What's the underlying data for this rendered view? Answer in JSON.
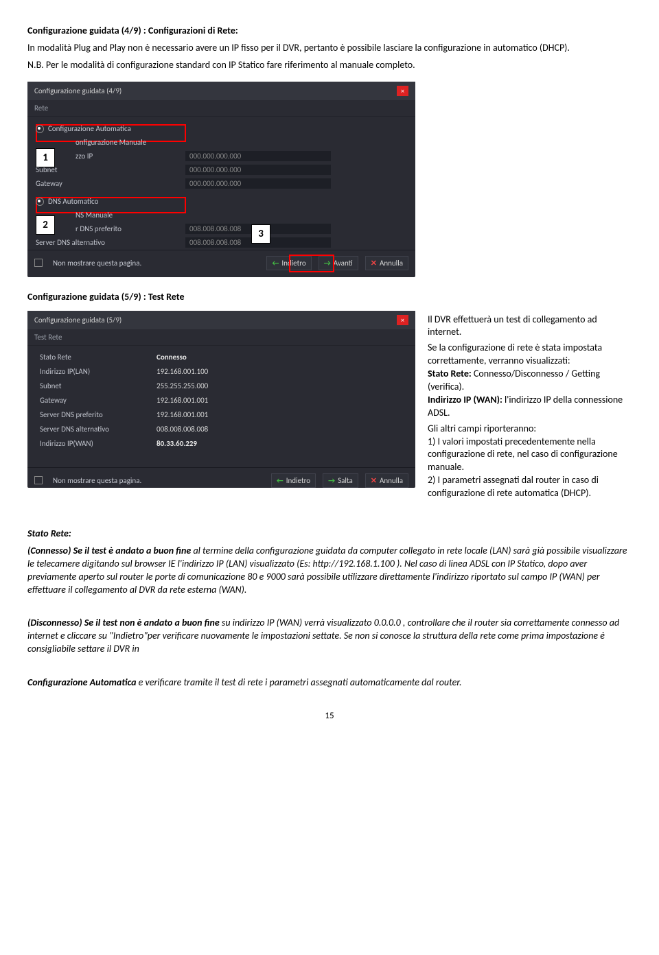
{
  "heading_4_9": "Configurazione guidata (4/9) : Configurazioni di Rete:",
  "intro_para": "In modalità Plug and Play non è necessario avere un IP fisso per il DVR, pertanto è possibile lasciare la configurazione in automatico (DHCP).",
  "nb_line": "N.B. Per le modalità di configurazione standard con IP Statico fare riferimento al manuale completo.",
  "shot1": {
    "title": "Configurazione guidata (4/9)",
    "subtitle": "Rete",
    "radio_auto": "Configurazione Automatica",
    "radio_manual": "onfigurazione Manuale",
    "ip_lbl": "zzo IP",
    "subnet_lbl": "Subnet",
    "gateway_lbl": "Gateway",
    "zeros": "000.000.000.000",
    "radio_dns_auto": "DNS Automatico",
    "radio_dns_manual": "NS Manuale",
    "dns_pref_lbl": "r DNS preferito",
    "dns_alt_lbl": "Server DNS alternativo",
    "eights": "008.008.008.008",
    "noshow": "Non mostrare questa pagina.",
    "back": "Indietro",
    "next": "Avanti",
    "cancel": "Annulla",
    "m1": "1",
    "m2": "2",
    "m3": "3"
  },
  "heading_5_9": "Configurazione guidata (5/9) : Test Rete",
  "shot2": {
    "title": "Configurazione guidata (5/9)",
    "subtitle": "Test Rete",
    "rows": {
      "stato_lbl": "Stato Rete",
      "stato_val": "Connesso",
      "iplan_lbl": "Indirizzo IP(LAN)",
      "iplan_val": "192.168.001.100",
      "subnet_lbl": "Subnet",
      "subnet_val": "255.255.255.000",
      "gateway_lbl": "Gateway",
      "gateway_val": "192.168.001.001",
      "dnspref_lbl": "Server DNS preferito",
      "dnspref_val": "192.168.001.001",
      "dnsalt_lbl": "Server DNS alternativo",
      "dnsalt_val": "008.008.008.008",
      "ipwan_lbl": "Indirizzo IP(WAN)",
      "ipwan_val": "80.33.60.229"
    },
    "noshow": "Non mostrare questa pagina.",
    "back": "Indietro",
    "skip": "Salta",
    "cancel": "Annulla"
  },
  "right": {
    "p1": "Il DVR effettuerà un test di collegamento ad internet.",
    "p2a": "Se la configurazione di rete è stata impostata correttamente, verranno visualizzati:",
    "p2b_bold": "Stato Rete:",
    "p2b": " Connesso/Disconnesso / Getting (verifica).",
    "p2c_bold": "Indirizzo IP (WAN):",
    "p2c": " l'indirizzo IP della connessione ADSL.",
    "p3a": "Gli altri campi riporteranno:",
    "p3b": " 1) I valori impostati precedentemente nella configurazione di rete, nel caso di configurazione manuale.",
    "p3c": "2) I parametri assegnati dal router in caso di configurazione di rete automatica (DHCP)."
  },
  "stato_heading": "Stato Rete:",
  "connesso_para_a_bold": "(Connesso) Se il test è andato a buon fine",
  "connesso_para_a": " al termine della configurazione guidata da computer collegato in rete locale (LAN) sarà già possibile visualizzare le telecamere digitando sul browser IE l'indirizzo IP (LAN) visualizzato       (Es: http://192.168.1.100 ). Nel caso di linea ADSL con IP Statico, dopo aver previamente aperto sul router le porte di comunicazione 80 e 9000 sarà possibile utilizzare direttamente l'indirizzo riportato sul campo IP (WAN) per effettuare il collegamento al DVR da rete esterna (WAN).",
  "disc_para_a_bold": "(Disconnesso) Se il test non è andato a buon fine",
  "disc_para_a_it": " su indirizzo IP (WAN) verrà visualizzato 0.0.0.0 , controllare che il router sia correttamente connesso ad internet e cliccare su \"Indietro\"per verificare nuovamente le impostazioni settate. Se non si conosce la struttura della rete come prima impostazione è consigliabile settare il DVR in",
  "conf_auto_bold": "Configurazione Automatica",
  "conf_auto_rest": " e verificare tramite il test di rete i parametri assegnati automaticamente dal router.",
  "page_number": "15"
}
